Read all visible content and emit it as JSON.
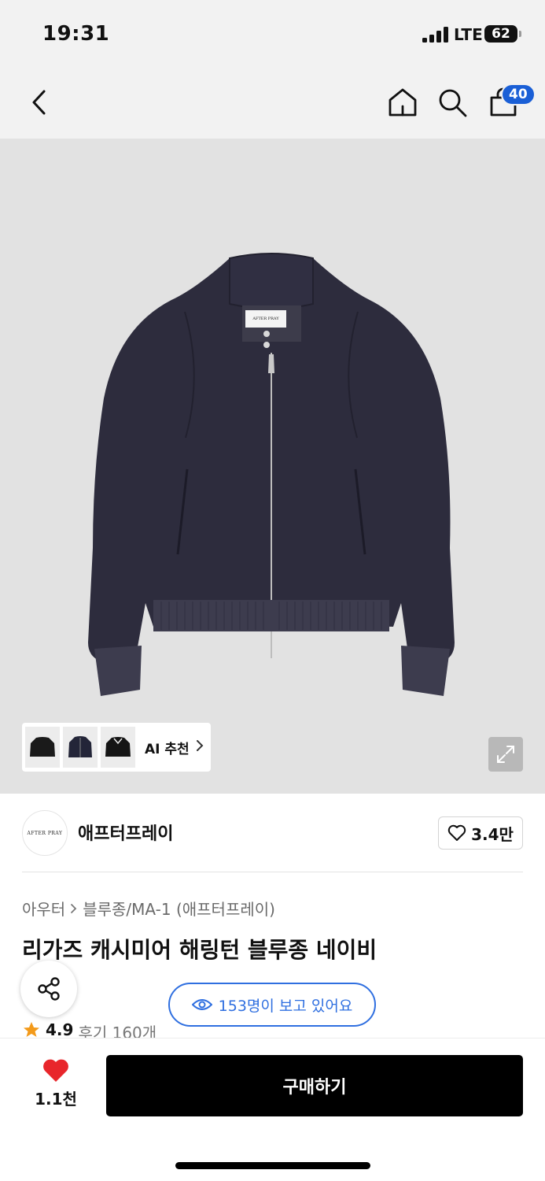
{
  "status": {
    "time": "19:31",
    "network": "LTE",
    "battery": "62"
  },
  "nav": {
    "cart_count": "40",
    "icons": [
      "back-icon",
      "home-icon",
      "search-icon",
      "cart-icon"
    ]
  },
  "gallery": {
    "image_subject": "navy cashmere harrington blouson jacket",
    "jacket_label": "AFTER PRAY",
    "ai_recommend_label": "AI 추천"
  },
  "brand": {
    "logo_text": "AFTER PRAY",
    "name": "애프터프레이",
    "likes": "3.4만"
  },
  "product": {
    "breadcrumb": [
      "아우터",
      "블루종/MA-1 (애프터프레이)"
    ],
    "title": "리가즈 캐시미어 해링턴 블루종 네이비",
    "viewers_text": "153명이 보고 있어요",
    "rating": "4.9",
    "reviews": "후기 160개"
  },
  "actions": {
    "wishlist_count": "1.1천",
    "buy_label": "구매하기"
  },
  "colors": {
    "accent_blue": "#2f6fe0",
    "badge_blue": "#1a5fd6",
    "heart_red": "#e8262b",
    "star_orange": "#f39a1a",
    "jacket_navy": "#2d2c3d"
  }
}
